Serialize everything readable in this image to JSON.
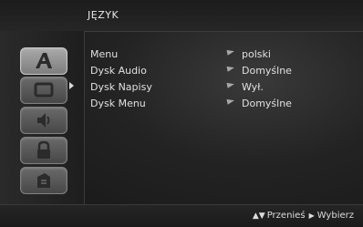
{
  "window": {
    "title": "JĘZYK"
  },
  "rail": {
    "tabs": [
      {
        "icon": "language-icon",
        "active": true
      },
      {
        "icon": "display-icon",
        "active": false
      },
      {
        "icon": "audio-icon",
        "active": false
      },
      {
        "icon": "lock-icon",
        "active": false
      },
      {
        "icon": "other-icon",
        "active": false
      }
    ]
  },
  "options": [
    {
      "label": "Menu",
      "value": "polski"
    },
    {
      "label": "Dysk Audio",
      "value": "Domyślne"
    },
    {
      "label": "Dysk Napisy",
      "value": "Wył."
    },
    {
      "label": "Dysk Menu",
      "value": "Domyślne"
    }
  ],
  "help": {
    "move_icon": "up-down-icon",
    "move_label": "Przenieś",
    "select_icon": "right-arrow-icon",
    "select_label": "Wybierz"
  }
}
